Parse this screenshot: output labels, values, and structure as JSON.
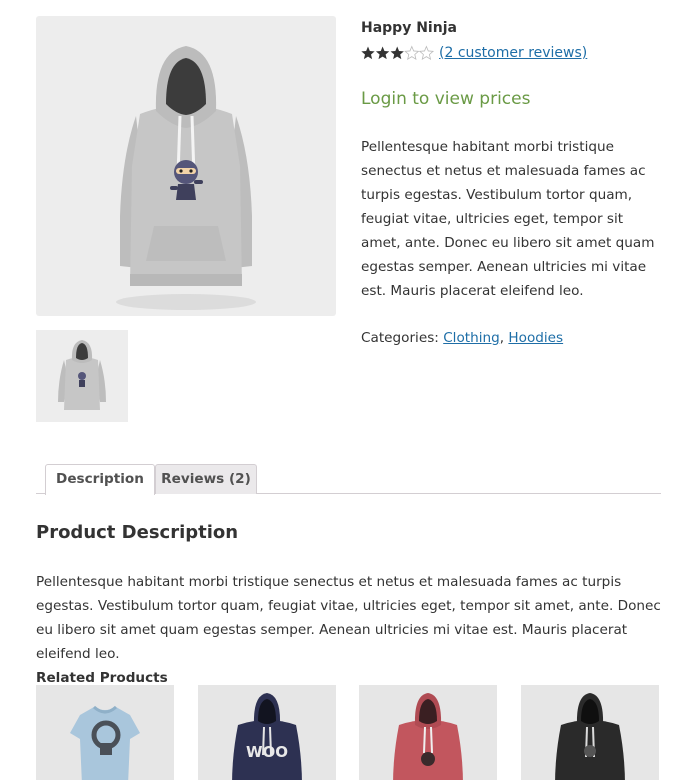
{
  "product": {
    "title": "Happy Ninja",
    "rating": 3,
    "rating_max": 5,
    "review_link": "(2 customer reviews)",
    "login_prices": "Login to view prices",
    "short_description": "Pellentesque habitant morbi tristique senectus et netus et malesuada fames ac turpis egestas. Vestibulum tortor quam, feugiat vitae, ultricies eget, tempor sit amet, ante. Donec eu libero sit amet quam egestas semper. Aenean ultricies mi vitae est. Mauris placerat eleifend leo.",
    "categories_label": "Categories: ",
    "categories": [
      "Clothing",
      "Hoodies"
    ],
    "category_separator": ", "
  },
  "tabs": [
    {
      "label": "Description",
      "active": true
    },
    {
      "label": "Reviews (2)",
      "active": false
    }
  ],
  "description_panel": {
    "heading": "Product Description",
    "text": "Pellentesque habitant morbi tristique senectus et netus et malesuada fames ac turpis egestas. Vestibulum tortor quam, feugiat vitae, ultricies eget, tempor sit amet, ante. Donec eu libero sit amet quam egestas semper. Aenean ultricies mi vitae est. Mauris placerat eleifend leo."
  },
  "related": {
    "heading": "Related Products",
    "items": [
      {
        "kind": "tshirt",
        "color": "#a9c6dc"
      },
      {
        "kind": "hoodie",
        "color": "#2d3152",
        "print": "WOO"
      },
      {
        "kind": "hoodie",
        "color": "#c2565e"
      },
      {
        "kind": "hoodie",
        "color": "#2a2a2a"
      }
    ]
  },
  "colors": {
    "link": "#1e6ea7",
    "price_login": "#6a9a45",
    "star": "#333333",
    "hoodie_main": "#c8c8c8"
  }
}
